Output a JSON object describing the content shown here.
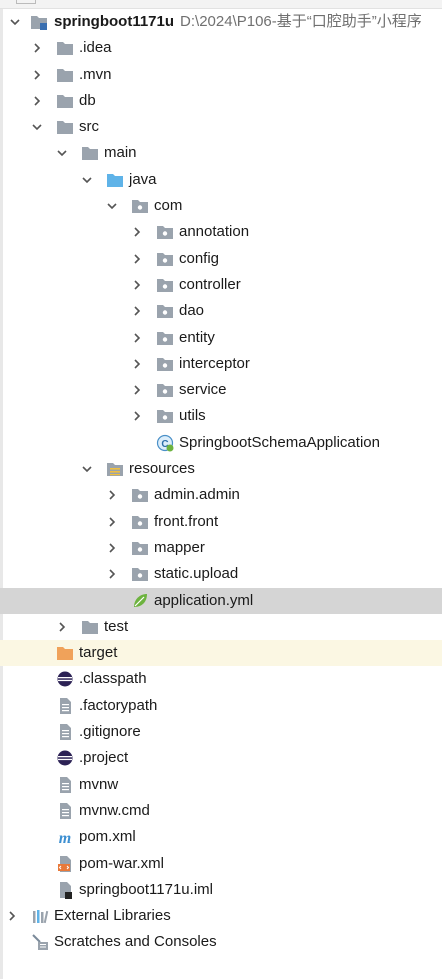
{
  "project": {
    "name": "springboot1171u",
    "path": "D:\\2024\\P106-基于“口腔助手”小程序"
  },
  "tree": {
    "idea": ".idea",
    "mvn": ".mvn",
    "db": "db",
    "src": "src",
    "main": "main",
    "java": "java",
    "com": "com",
    "annotation": "annotation",
    "config": "config",
    "controller": "controller",
    "dao": "dao",
    "entity": "entity",
    "interceptor": "interceptor",
    "service": "service",
    "utils": "utils",
    "app_class": "SpringbootSchemaApplication",
    "resources": "resources",
    "admin": "admin.admin",
    "front": "front.front",
    "mapper": "mapper",
    "static": "static.upload",
    "application_yml": "application.yml",
    "test": "test",
    "target": "target",
    "classpath": ".classpath",
    "factorypath": ".factorypath",
    "gitignore": ".gitignore",
    "project_file": ".project",
    "mvnw": "mvnw",
    "mvnw_cmd": "mvnw.cmd",
    "pom": "pom.xml",
    "pom_war": "pom-war.xml",
    "iml": "springboot1171u.iml",
    "external_libraries": "External Libraries",
    "scratches": "Scratches and Consoles"
  },
  "colors": {
    "folder_gray": "#9aa3ad",
    "folder_blue": "#5fb3e8",
    "folder_orange": "#f0a25a",
    "spring_green": "#6db33f",
    "selected_bg": "#d5d5d5",
    "excluded_bg": "#fbf7e3"
  }
}
